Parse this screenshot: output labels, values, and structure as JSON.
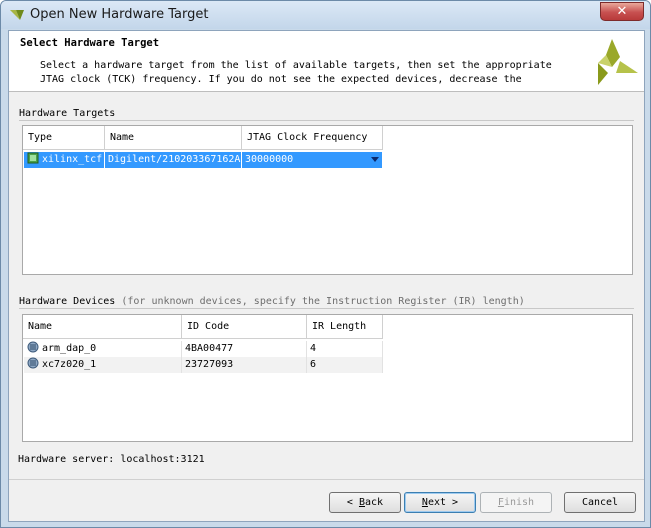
{
  "window": {
    "title": "Open New Hardware Target",
    "close_glyph": "✕"
  },
  "header": {
    "title": "Select Hardware Target",
    "description": "Select a hardware target from the list of available targets, then set the appropriate\nJTAG clock (TCK) frequency. If you do not see the expected devices, decrease the",
    "logo_icon": "xilinx-logo-icon",
    "logo_color": "#8a9a1b"
  },
  "targets": {
    "section_label": "Hardware Targets",
    "columns": [
      "Type",
      "Name",
      "JTAG Clock Frequency"
    ],
    "rows": [
      {
        "type": "xilinx_tcf",
        "name": "Digilent/210203367162A",
        "frequency": "30000000",
        "icon": "target-chip-icon",
        "selected": true
      }
    ]
  },
  "devices": {
    "section_label": "Hardware Devices",
    "section_hint": "(for unknown devices, specify the Instruction Register (IR) length)",
    "columns": [
      "Name",
      "ID Code",
      "IR Length"
    ],
    "rows": [
      {
        "name": "arm_dap_0",
        "id_code": "4BA00477",
        "ir_length": "4",
        "icon": "device-icon"
      },
      {
        "name": "xc7z020_1",
        "id_code": "23727093",
        "ir_length": "6",
        "icon": "device-icon"
      }
    ]
  },
  "server": {
    "label": "Hardware server: localhost:3121"
  },
  "buttons": {
    "back": {
      "mnemonic": "B",
      "rest": "ack",
      "prefix": "< "
    },
    "next": {
      "mnemonic": "N",
      "rest": "ext",
      "suffix": " >"
    },
    "finish": {
      "mnemonic": "F",
      "rest": "inish"
    },
    "cancel": {
      "label": "Cancel"
    }
  },
  "colors": {
    "selection": "#3399ff",
    "titlebar": "#c3d6ea",
    "close": "#c75050"
  }
}
